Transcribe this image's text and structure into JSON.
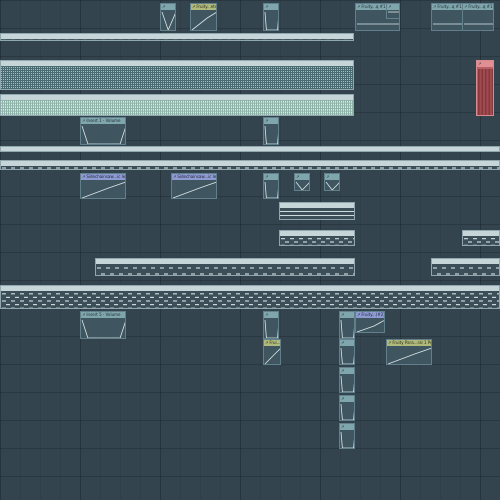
{
  "playlist": {
    "colors": {
      "background": "#34444f",
      "grid_line": "#2a3841",
      "automation_header": "#7fa6ad",
      "automation_header_olive": "#b0b97c",
      "automation_header_purple": "#8e9bd3",
      "pattern_header": "#c6d5d8",
      "highlight_red": "#e08f93"
    },
    "automation_clips": [
      {
        "label": "",
        "icon": "automation-clip-icon",
        "style": "teal"
      },
      {
        "label": "Fruity...ets",
        "icon": "automation-clip-icon",
        "style": "olive"
      },
      {
        "label": "",
        "icon": "automation-clip-icon",
        "style": "teal"
      },
      {
        "label": "Fruity...q #1",
        "icon": "automation-clip-icon",
        "style": "teal"
      },
      {
        "label": "",
        "icon": "automation-clip-icon",
        "style": "teal"
      },
      {
        "label": "Fruity...q #1",
        "icon": "automation-clip-icon",
        "style": "teal"
      },
      {
        "label": "Fruity...q #1",
        "icon": "automation-clip-icon",
        "style": "teal"
      },
      {
        "label": "Insert 1 - Volume",
        "icon": "automation-clip-icon",
        "style": "teal"
      },
      {
        "label": "",
        "icon": "automation-clip-icon",
        "style": "teal"
      },
      {
        "label": "Sidechainsaw...ic level",
        "icon": "automation-clip-icon",
        "style": "purple"
      },
      {
        "label": "Sidechainsaw...ic level",
        "icon": "automation-clip-icon",
        "style": "purple"
      },
      {
        "label": "",
        "icon": "automation-clip-icon",
        "style": "teal"
      },
      {
        "label": "",
        "icon": "automation-clip-icon",
        "style": "teal"
      },
      {
        "label": "",
        "icon": "automation-clip-icon",
        "style": "teal"
      },
      {
        "label": "Insert 5 - Volume",
        "icon": "automation-clip-icon",
        "style": "teal"
      },
      {
        "label": "",
        "icon": "automation-clip-icon",
        "style": "teal"
      },
      {
        "label": "",
        "icon": "automation-clip-icon",
        "style": "teal"
      },
      {
        "label": "Fruity...(#2)",
        "icon": "automation-clip-icon",
        "style": "purple"
      },
      {
        "label": "Frui...1",
        "icon": "automation-clip-icon",
        "style": "olive"
      },
      {
        "label": "Fruity Para...ral 1 Pos",
        "icon": "automation-clip-icon",
        "style": "olive"
      },
      {
        "label": "",
        "icon": "automation-clip-icon",
        "style": "teal"
      },
      {
        "label": "",
        "icon": "automation-clip-icon",
        "style": "teal"
      },
      {
        "label": "",
        "icon": "automation-clip-icon",
        "style": "teal"
      },
      {
        "label": "",
        "icon": "automation-clip-icon",
        "style": "teal"
      },
      {
        "label": "",
        "icon": "automation-clip-icon",
        "style": "teal"
      }
    ],
    "pattern_clips": [
      {
        "label": "",
        "style": "teal"
      },
      {
        "label": "",
        "style": "mint"
      },
      {
        "label": "",
        "style": "pale"
      },
      {
        "label": "",
        "style": "grey"
      },
      {
        "label": "",
        "style": "grey"
      },
      {
        "label": "",
        "style": "grey"
      },
      {
        "label": "",
        "style": "grey"
      },
      {
        "label": "",
        "style": "grey"
      },
      {
        "label": "",
        "style": "grey"
      },
      {
        "label": "",
        "style": "grey"
      },
      {
        "label": "",
        "style": "grey"
      }
    ]
  }
}
